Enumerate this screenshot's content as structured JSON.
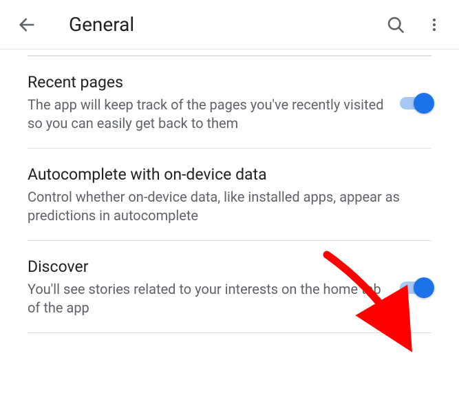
{
  "header": {
    "title": "General"
  },
  "settings": [
    {
      "title": "Recent pages",
      "description": "The app will keep track of the pages you've recently visited so you can easily get back to them",
      "toggled": true,
      "has_toggle": true
    },
    {
      "title": "Autocomplete with on-device data",
      "description": "Control whether on-device data, like installed apps, appear as predictions in autocomplete",
      "toggled": null,
      "has_toggle": false
    },
    {
      "title": "Discover",
      "description": "You'll see stories related to your interests on the home tab of the app",
      "toggled": true,
      "has_toggle": true
    }
  ],
  "annotation": {
    "arrow_color": "#ff0000"
  }
}
